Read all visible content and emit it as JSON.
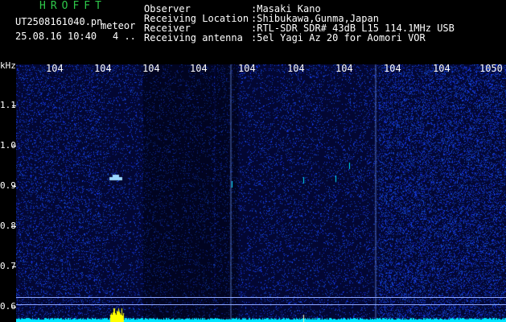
{
  "header": {
    "app_title": "HROFFT",
    "file_name": "UT2508161040.pn",
    "meteor_tag": "meteor",
    "date_time": "25.08.16 10:40",
    "count": "4 .."
  },
  "info": [
    {
      "label": "Observer",
      "value": ":Masaki Kano"
    },
    {
      "label": "Receiving Location",
      "value": ":Shibukawa,Gunma,Japan"
    },
    {
      "label": "Receiver",
      "value": ":RTL-SDR SDR# 43dB L15 114.1MHz USB"
    },
    {
      "label": "Receiving antenna",
      "value": ":5el Yagi Az 20 for Aomori VOR"
    }
  ],
  "axes": {
    "y_unit": "kHz",
    "x_ticks": [
      "104",
      "104",
      "104",
      "104",
      "104",
      "104",
      "104",
      "104",
      "104",
      "1050"
    ],
    "y_ticks": [
      "1.1",
      "1.0",
      "0.9",
      "0.8",
      "0.7",
      "0.6"
    ]
  },
  "colors": {
    "background": "#000000",
    "plot_bg": "#030733",
    "title": "#2ec84a",
    "signal_band": "#00e5ff",
    "echo": "#ffff00"
  }
}
